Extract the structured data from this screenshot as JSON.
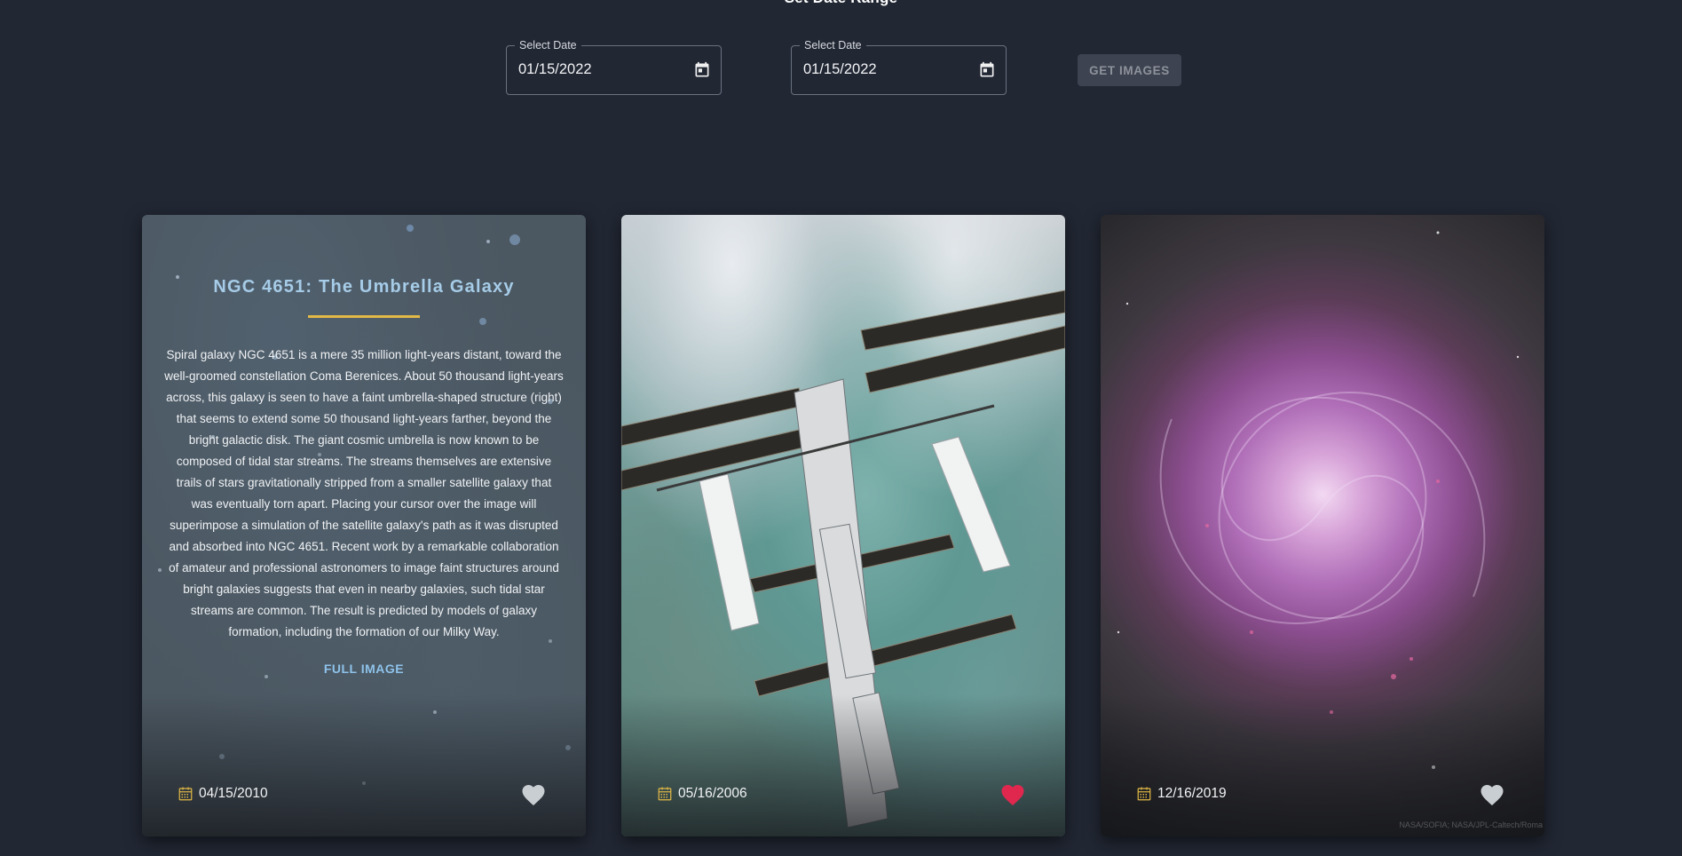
{
  "header": {
    "section_title": "Set Date Range"
  },
  "date_range": {
    "start": {
      "label": "Select Date",
      "value": "01/15/2022",
      "icon": "calendar-icon"
    },
    "end": {
      "label": "Select Date",
      "value": "01/15/2022",
      "icon": "calendar-icon"
    },
    "submit_label": "GET IMAGES"
  },
  "cards": [
    {
      "title": "NGC 4651: The Umbrella Galaxy",
      "description": "Spiral galaxy NGC 4651 is a mere 35 million light-years distant, toward the well-groomed constellation Coma Berenices. About 50 thousand light-years across, this galaxy is seen to have a faint umbrella-shaped structure (right) that seems to extend some 50 thousand light-years farther, beyond the bright galactic disk. The giant cosmic umbrella is now known to be composed of tidal star streams. The streams themselves are extensive trails of stars gravitationally stripped from a smaller satellite galaxy that was eventually torn apart. Placing your cursor over the image will superimpose a simulation of the satellite galaxy's path as it was disrupted and absorbed into NGC 4651. Recent work by a remarkable collaboration of amateur and professional astronomers to image faint structures around bright galaxies suggests that even in nearby galaxies, such tidal star streams are common. The result is predicted by models of galaxy formation, including the formation of our Milky Way.",
      "link_label": "FULL IMAGE",
      "date": "04/15/2010",
      "liked": false
    },
    {
      "date": "05/16/2006",
      "liked": true
    },
    {
      "date": "12/16/2019",
      "liked": false,
      "credit": "NASA/SOFIA; NASA/JPL-Caltech/Roma"
    }
  ],
  "colors": {
    "background": "#212733",
    "accent_underline": "#e2b946",
    "title_blue": "#a6cce8",
    "heart_liked": "#e0284f",
    "heart_unliked": "#c9ced3",
    "calendar_icon": "#e2b946"
  }
}
